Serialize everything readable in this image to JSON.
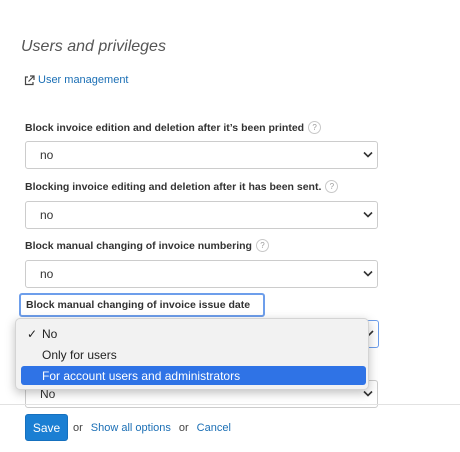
{
  "section": {
    "title": "Users and privileges"
  },
  "link": {
    "label": "User management"
  },
  "fields": [
    {
      "label": "Block invoice edition and deletion after it’s been printed",
      "value": "no"
    },
    {
      "label": "Blocking invoice editing and deletion after it has been sent.",
      "value": "no"
    },
    {
      "label": "Block manual changing of invoice numbering",
      "value": "no"
    },
    {
      "label": "Block manual changing of invoice issue date",
      "value": "No"
    }
  ],
  "help_icon": "?",
  "dropdown": {
    "check": "✓",
    "options": [
      "No",
      "Only for users",
      "For account users and administrators"
    ],
    "checked_index": 0,
    "highlighted_index": 2
  },
  "footer": {
    "save_label": "Save",
    "or1": "or",
    "show_all_label": "Show all options",
    "or2": "or",
    "cancel_label": "Cancel"
  },
  "colors": {
    "accent": "#1b7fd3",
    "link": "#1b6fb5",
    "focus": "#6d9eeb",
    "highlight": "#2f73e6"
  }
}
